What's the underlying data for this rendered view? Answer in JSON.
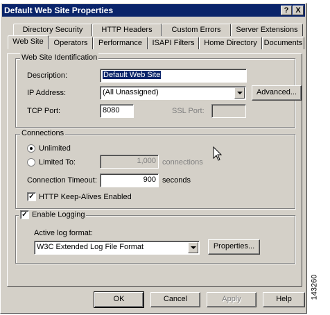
{
  "window": {
    "title": "Default Web Site Properties",
    "help_btn": "?",
    "close_btn": "X"
  },
  "tabs_back": [
    {
      "label": "Directory Security"
    },
    {
      "label": "HTTP Headers"
    },
    {
      "label": "Custom Errors"
    },
    {
      "label": "Server Extensions"
    }
  ],
  "tabs_front": [
    {
      "label": "Web Site",
      "active": true
    },
    {
      "label": "Operators"
    },
    {
      "label": "Performance"
    },
    {
      "label": "ISAPI Filters"
    },
    {
      "label": "Home Directory"
    },
    {
      "label": "Documents"
    }
  ],
  "identification": {
    "legend": "Web Site Identification",
    "description_label": "Description:",
    "description_value": "Default Web Site",
    "ip_label": "IP Address:",
    "ip_value": "(All Unassigned)",
    "advanced_btn": "Advanced...",
    "tcp_label": "TCP Port:",
    "tcp_value": "8080",
    "ssl_label": "SSL Port:",
    "ssl_value": ""
  },
  "connections": {
    "legend": "Connections",
    "unlimited_label": "Unlimited",
    "limited_label": "Limited To:",
    "limited_value": "1,000",
    "limited_unit": "connections",
    "timeout_label": "Connection Timeout:",
    "timeout_value": "900",
    "timeout_unit": "seconds",
    "keepalive_label": "HTTP Keep-Alives Enabled",
    "unlimited_selected": true,
    "keepalive_checked": true
  },
  "logging": {
    "enable_label": "Enable Logging",
    "enabled": true,
    "format_label": "Active log format:",
    "format_value": "W3C Extended Log File Format",
    "properties_btn": "Properties..."
  },
  "buttons": {
    "ok": "OK",
    "cancel": "Cancel",
    "apply": "Apply",
    "help": "Help"
  },
  "side_code": "143260"
}
